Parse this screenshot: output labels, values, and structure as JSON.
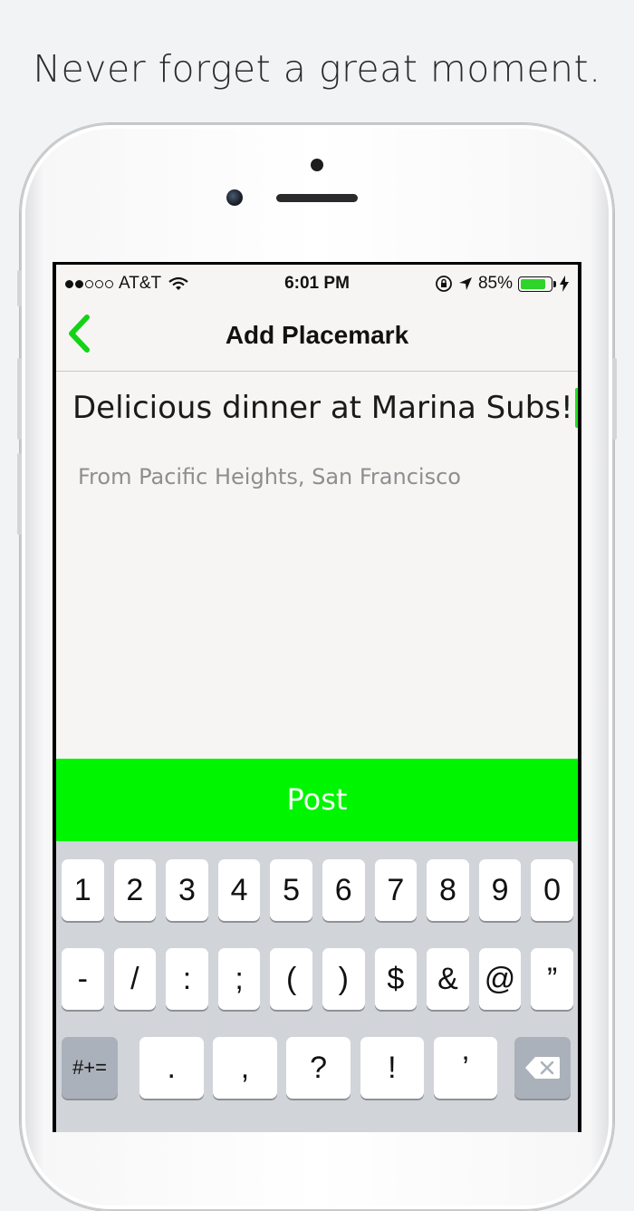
{
  "headline": "Never forget a great moment.",
  "status_bar": {
    "carrier": "AT&T",
    "time": "6:01 PM",
    "battery": "85%"
  },
  "nav": {
    "title": "Add Placemark"
  },
  "compose": {
    "text": "Delicious dinner at Marina Subs!",
    "location": "From Pacific Heights, San Francisco"
  },
  "post_label": "Post",
  "accent_color": "#00f500",
  "keyboard": {
    "row1": [
      "1",
      "2",
      "3",
      "4",
      "5",
      "6",
      "7",
      "8",
      "9",
      "0"
    ],
    "row2": [
      "-",
      "/",
      ":",
      ";",
      "(",
      ")",
      "$",
      "&",
      "@",
      "”"
    ],
    "row3_mode": "#+=",
    "row3": [
      ".",
      ",",
      "?",
      "!",
      "’"
    ]
  }
}
